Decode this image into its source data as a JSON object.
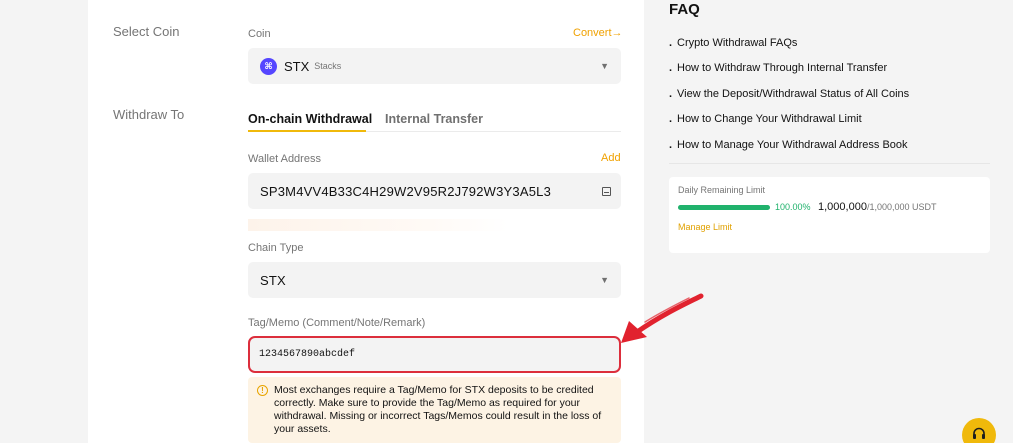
{
  "select_coin": {
    "section_label": "Select Coin",
    "field_label": "Coin",
    "convert_label": "Convert",
    "convert_arrow": "→",
    "selected_symbol": "STX",
    "selected_name": "Stacks",
    "coin_icon_glyph": "⌘",
    "caret": "▼"
  },
  "withdraw_to": {
    "section_label": "Withdraw To",
    "tabs": [
      {
        "label": "On-chain Withdrawal",
        "active": true
      },
      {
        "label": "Internal Transfer",
        "active": false
      }
    ]
  },
  "wallet": {
    "label": "Wallet Address",
    "add_label": "Add",
    "value": "SP3M4VV4B33C4H29W2V95R2J792W3Y3A5L3"
  },
  "chain": {
    "label": "Chain Type",
    "value": "STX",
    "caret": "▼"
  },
  "memo": {
    "label": "Tag/Memo (Comment/Note/Remark)",
    "value": "1234567890abcdef"
  },
  "warning": {
    "icon_glyph": "!",
    "text": "Most exchanges require a Tag/Memo for STX deposits to be credited correctly. Make sure to provide the Tag/Memo as required for your withdrawal. Missing or incorrect Tags/Memos could result in the loss of your assets."
  },
  "faq": {
    "title": "FAQ",
    "bullet": ".",
    "items": [
      "Crypto Withdrawal FAQs",
      "How to Withdraw Through Internal Transfer",
      "View the Deposit/Withdrawal Status of All Coins",
      "How to Change Your Withdrawal Limit",
      "How to Manage Your Withdrawal Address Book"
    ]
  },
  "limit": {
    "label": "Daily Remaining Limit",
    "percent": "100.00%",
    "fill_fraction": 1.0,
    "remaining": "1,000,000",
    "total": "/1,000,000 USDT",
    "manage_label": "Manage Limit"
  },
  "colors": {
    "accent": "#f0b90b",
    "link": "#f0a100",
    "success": "#20b26c",
    "highlight_border": "#dc2e3c",
    "annotation_arrow": "#e1222e"
  },
  "icons": {
    "support": "headset-icon",
    "address_book": "address-book-icon",
    "warning": "warning-icon",
    "coin": "stx-coin-icon"
  }
}
